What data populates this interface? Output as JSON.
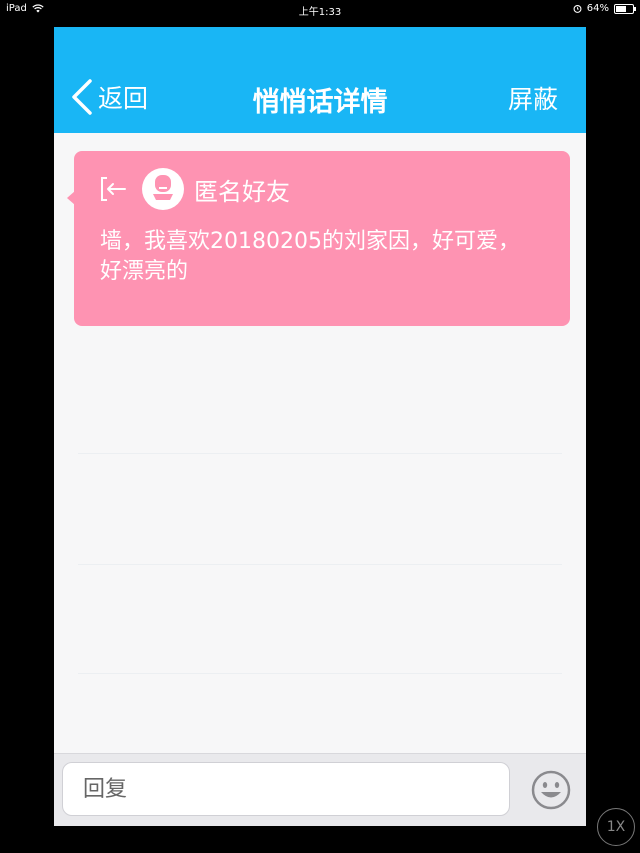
{
  "status_bar": {
    "device": "iPad",
    "time": "上午1:33",
    "battery_percent": "64%",
    "battery_level": 0.64,
    "wifi_icon": "wifi-icon",
    "alarm_icon": "alarm-icon"
  },
  "nav": {
    "back_label": "返回",
    "title": "悄悄话详情",
    "block_label": "屏蔽"
  },
  "message": {
    "sender": "匿名好友",
    "text": "墙，我喜欢20180205的刘家因，好可爱，好漂亮的",
    "card_color": "#fe93b2",
    "avatar_icon": "anonymous-avatar-icon",
    "exit_icon": "exit-arrow-icon"
  },
  "reply": {
    "placeholder": "回复",
    "emoji_icon": "emoji-icon"
  },
  "zoom_label": "1X",
  "colors": {
    "nav_bar": "#19b6f5",
    "background": "#f7f7f8"
  }
}
